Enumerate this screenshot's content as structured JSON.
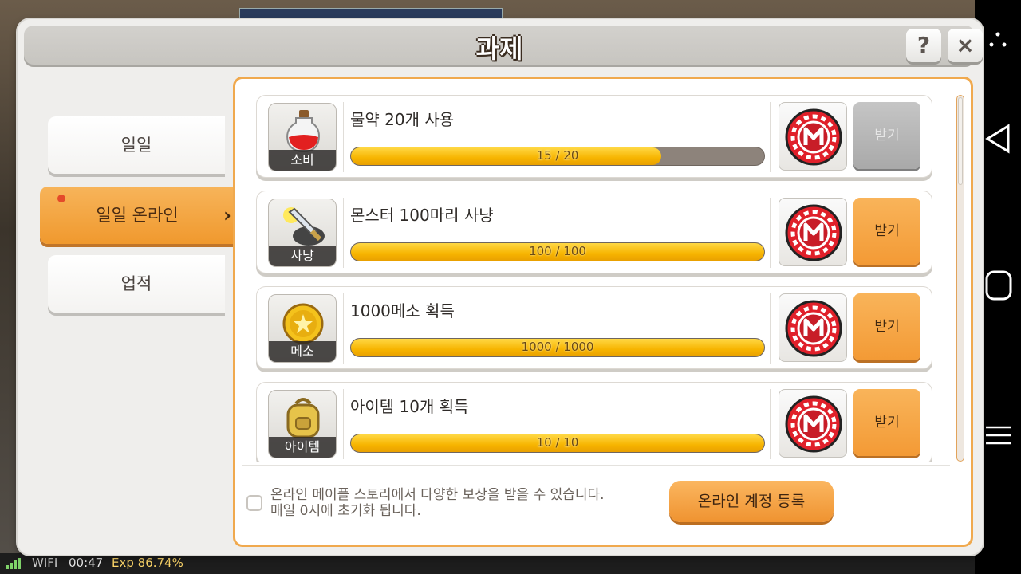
{
  "window": {
    "title": "과제"
  },
  "buttons": {
    "help_label": "?",
    "close_label": "×",
    "register_label": "온라인 계정 등록"
  },
  "tabs": [
    {
      "label": "일일",
      "active": false
    },
    {
      "label": "일일 온라인",
      "active": true,
      "has_alert": true
    },
    {
      "label": "업적",
      "active": false
    }
  ],
  "quests": [
    {
      "title": "물약 20개 사용",
      "category": "소비",
      "icon": "potion-icon",
      "progress_text": "15 / 20",
      "progress": 0.75,
      "reward_icon": "maple-point-coin-icon",
      "claim_label": "받기",
      "claimable": false
    },
    {
      "title": "몬스터 100마리 사냥",
      "category": "사냥",
      "icon": "sword-icon",
      "progress_text": "100 / 100",
      "progress": 1.0,
      "reward_icon": "maple-point-coin-icon",
      "claim_label": "받기",
      "claimable": true
    },
    {
      "title": "1000메소 획득",
      "category": "메소",
      "icon": "meso-coin-icon",
      "progress_text": "1000 / 1000",
      "progress": 1.0,
      "reward_icon": "maple-point-coin-icon",
      "claim_label": "받기",
      "claimable": true
    },
    {
      "title": "아이템 10개 획득",
      "category": "아이템",
      "icon": "backpack-icon",
      "progress_text": "10 / 10",
      "progress": 1.0,
      "reward_icon": "maple-point-coin-icon",
      "claim_label": "받기",
      "claimable": true
    }
  ],
  "footer": {
    "notice_line1": "온라인 메이플 스토리에서 다양한 보상을 받을 수 있습니다.",
    "notice_line2": "매일 0시에 초기화 됩니다."
  },
  "status_bar": {
    "network": "WIFI",
    "time": "00:47",
    "exp": "Exp 86.74%"
  },
  "colors": {
    "accent_orange": "#f39a35",
    "progress_yellow": "#f7b400",
    "panel_bg": "#efeeec"
  }
}
